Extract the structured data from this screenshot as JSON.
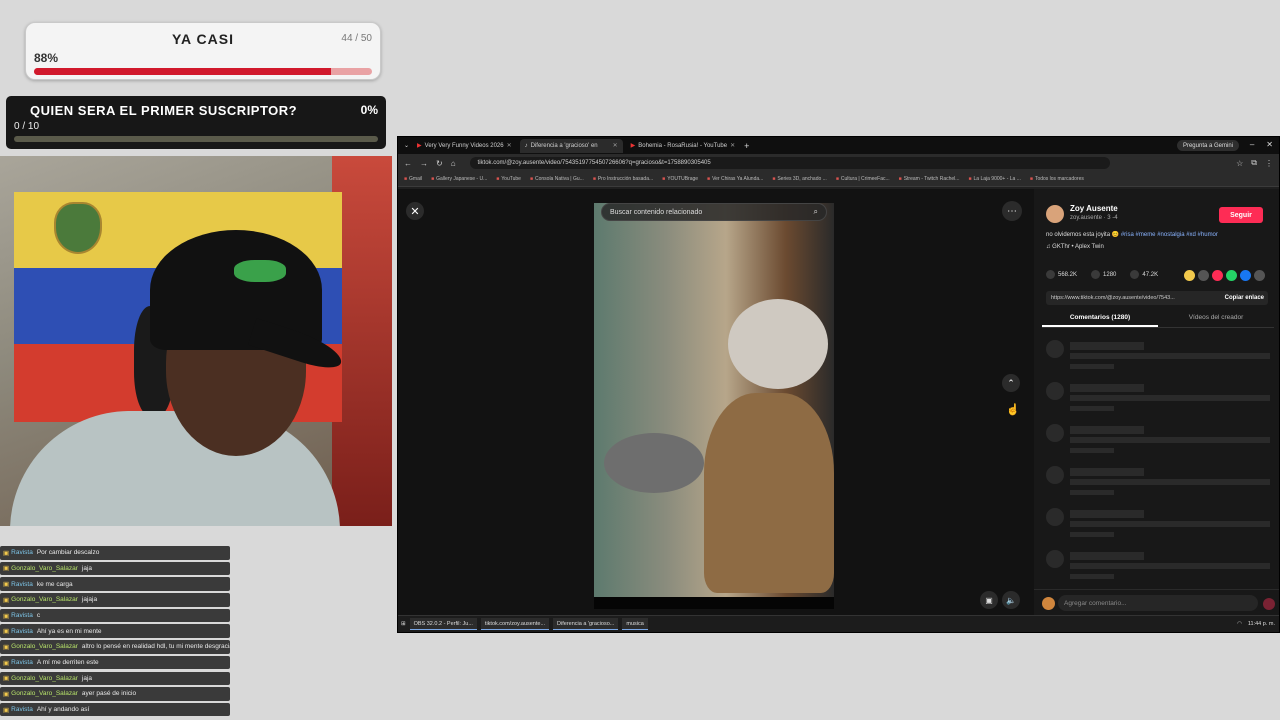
{
  "goal_top": {
    "title": "YA CASI",
    "count": "44 / 50",
    "percent_label": "88%",
    "progress": 0.88
  },
  "goal_sub": {
    "title": "QUIEN SERA EL PRIMER SUSCRIPTOR?",
    "percent_label": "0%",
    "count": "0 / 10",
    "progress": 0.0
  },
  "chat": [
    {
      "user": "Ravista",
      "msg": "Por cambiar descalzo"
    },
    {
      "user": "Gonzalo_Varo_Salazar",
      "msg": "jaja"
    },
    {
      "user": "Ravista",
      "msg": "ke me carga"
    },
    {
      "user": "Gonzalo_Varo_Salazar",
      "msg": "jajaja"
    },
    {
      "user": "Ravista",
      "msg": "c"
    },
    {
      "user": "Ravista",
      "msg": "Ahí ya es en mi mente"
    },
    {
      "user": "Gonzalo_Varo_Salazar",
      "msg": "altro lo pensé en realidad hdl, tu mi mente desgraciado"
    },
    {
      "user": "Ravista",
      "msg": "A mí me derriten este"
    },
    {
      "user": "Gonzalo_Varo_Salazar",
      "msg": "jaja"
    },
    {
      "user": "Gonzalo_Varo_Salazar",
      "msg": "ayer pasé de inicio"
    },
    {
      "user": "Ravista",
      "msg": "Ahí y andando así"
    }
  ],
  "browser": {
    "tabs": [
      {
        "label": "Very Very Funny Videos 2026",
        "active": false
      },
      {
        "label": "Diferencia a 'gracioso' en",
        "active": true
      },
      {
        "label": "Bohemia - RosaRusia! - YouTube",
        "active": false
      }
    ],
    "gemini_label": "Pregunta a Gemini",
    "url": "tiktok.com/@zoy.ausente/video/7543519775450726606?q=gracioso&t=1758890305405",
    "bookmarks": [
      "Gmail",
      "Gallery Japanese - U...",
      "YouTube",
      "Consola Nativa | Gu...",
      "Pro Instrucción basada...",
      "YOUTUBrage",
      "Ver Chiras Ya Alunda...",
      "Series 3D, anchado ...",
      "Cultura | CrimeeFac...",
      "Stream - Twitch Rachel...",
      "La Laja 9000+ - La ...",
      "Todos los marcadores"
    ],
    "video_search": "Buscar contenido relacionado",
    "creator": {
      "name": "Zoy Ausente",
      "handle": "zoy.ausente · 3 -4",
      "follow_label": "Seguir"
    },
    "description": "no olvidemos esta joyita 😊",
    "hashtags": "#risa #meme #nostalgia #xd #humor",
    "music": "♫ GKThr • Aplex Twin",
    "stats": {
      "likes": "568.2K",
      "comments": "1280",
      "saves": "47.2K"
    },
    "link": "https://www.tiktok.com/@zoy.ausente/video/7543...",
    "copy_label": "Copiar enlace",
    "panel_tabs": [
      "Comentarios (1280)",
      "Vídeos del creador"
    ],
    "comment_placeholder": "Agregar comentario...",
    "taskbar": [
      "OBS 32.0.2 - Perfil: Ju...",
      "tiktok.com/zoy.ausente...",
      "Diferencia a 'gracioso...",
      "musica"
    ],
    "clock": "11:44 p. m."
  },
  "colors": {
    "goal_fill": "#d1192c",
    "tiktok_red": "#fe2c55"
  }
}
